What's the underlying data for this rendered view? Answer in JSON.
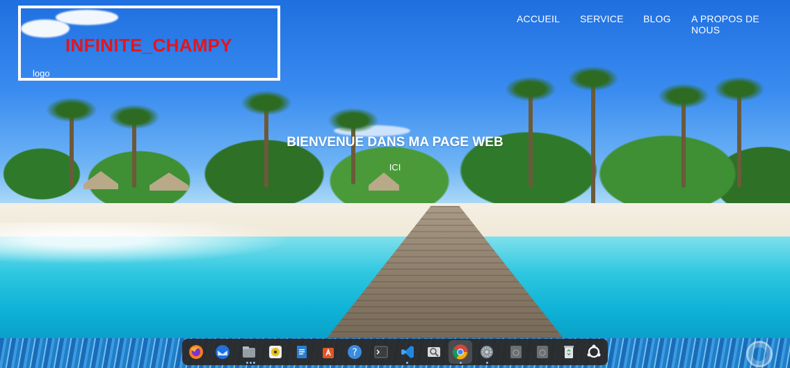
{
  "header": {
    "site_title": "INFINITE_CHAMPY",
    "logo_label": "logo"
  },
  "nav": {
    "items": [
      "ACCUEIL",
      "SERVICE",
      "BLOG",
      "A PROPOS DE NOUS"
    ]
  },
  "hero": {
    "title": "BIENVENUE DANS MA PAGE WEB",
    "subtitle": "ICI"
  },
  "colors": {
    "title_red": "#e5141c",
    "text_white": "#ffffff",
    "dock_bg": "#2b2b2b"
  },
  "dock": {
    "items": [
      {
        "name": "firefox",
        "icon": "firefox-icon"
      },
      {
        "name": "thunderbird",
        "icon": "thunderbird-icon",
        "running": true
      },
      {
        "name": "files",
        "icon": "files-icon",
        "running": true
      },
      {
        "name": "rhythmbox",
        "icon": "rhythmbox-icon"
      },
      {
        "name": "writer",
        "icon": "writer-icon"
      },
      {
        "name": "software",
        "icon": "software-icon"
      },
      {
        "name": "help",
        "icon": "help-icon"
      },
      {
        "name": "terminal",
        "icon": "terminal-icon"
      },
      {
        "name": "vscode",
        "icon": "vscode-icon",
        "running": true
      },
      {
        "name": "image-viewer",
        "icon": "image-viewer-icon"
      },
      {
        "name": "chrome",
        "icon": "chrome-icon",
        "running": true,
        "active": true
      },
      {
        "name": "settings",
        "icon": "settings-icon",
        "running": true
      },
      {
        "name": "drive-1",
        "icon": "drive-icon"
      },
      {
        "name": "drive-2",
        "icon": "drive-icon"
      },
      {
        "name": "trash",
        "icon": "trash-icon"
      },
      {
        "name": "app-grid",
        "icon": "app-grid-icon"
      }
    ]
  }
}
